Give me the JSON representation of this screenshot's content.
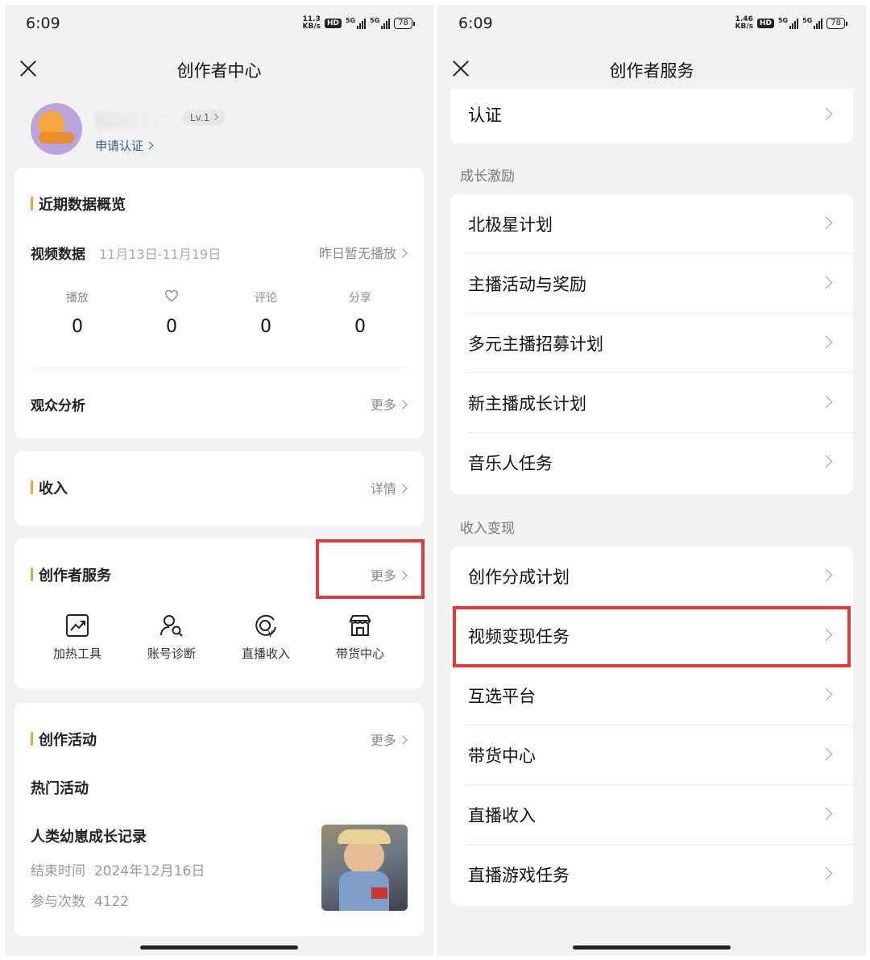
{
  "left": {
    "status": {
      "time": "6:09",
      "speed_top": "11.3",
      "speed_unit": "KB/s",
      "hd": "HD",
      "net1": "5G",
      "net2": "5G",
      "battery": "78"
    },
    "nav": {
      "title": "创作者中心"
    },
    "profile": {
      "level": "Lv.1",
      "apply": "申请认证"
    },
    "overview": {
      "title": "近期数据概览",
      "video_label": "视频数据",
      "date_range": "11月13日-11月19日",
      "yesterday": "昨日暂无播放",
      "stats": [
        {
          "label": "播放",
          "value": "0"
        },
        {
          "label": "",
          "icon": "heart-icon",
          "value": "0"
        },
        {
          "label": "评论",
          "value": "0"
        },
        {
          "label": "分享",
          "value": "0"
        }
      ],
      "audience": "观众分析",
      "audience_more": "更多"
    },
    "income": {
      "title": "收入",
      "more": "详情"
    },
    "services": {
      "title": "创作者服务",
      "more": "更多",
      "tools": [
        {
          "label": "加热工具",
          "icon": "trend-chart-icon"
        },
        {
          "label": "账号诊断",
          "icon": "user-search-icon"
        },
        {
          "label": "直播收入",
          "icon": "yuan-live-icon"
        },
        {
          "label": "带货中心",
          "icon": "store-icon"
        }
      ]
    },
    "activity": {
      "title": "创作活动",
      "more": "更多",
      "hot": "热门活动",
      "item_title": "人类幼崽成长记录",
      "end_label": "结束时间",
      "end_value": "2024年12月16日",
      "count_label": "参与次数",
      "count_value": "4122"
    }
  },
  "right": {
    "status": {
      "time": "6:09",
      "speed_top": "1.46",
      "speed_unit": "KB/s",
      "hd": "HD",
      "net1": "5G",
      "net2": "5G",
      "battery": "78"
    },
    "nav": {
      "title": "创作者服务"
    },
    "top_item": "认证",
    "groups": [
      {
        "title": "成长激励",
        "items": [
          "北极星计划",
          "主播活动与奖励",
          "多元主播招募计划",
          "新主播成长计划",
          "音乐人任务"
        ]
      },
      {
        "title": "收入变现",
        "items": [
          "创作分成计划",
          "视频变现任务",
          "互选平台",
          "带货中心",
          "直播收入",
          "直播游戏任务"
        ]
      }
    ]
  },
  "colors": {
    "accent_bar": "#f0a23c",
    "highlight_box": "#e53935",
    "link_blue": "#3a5a8c"
  }
}
